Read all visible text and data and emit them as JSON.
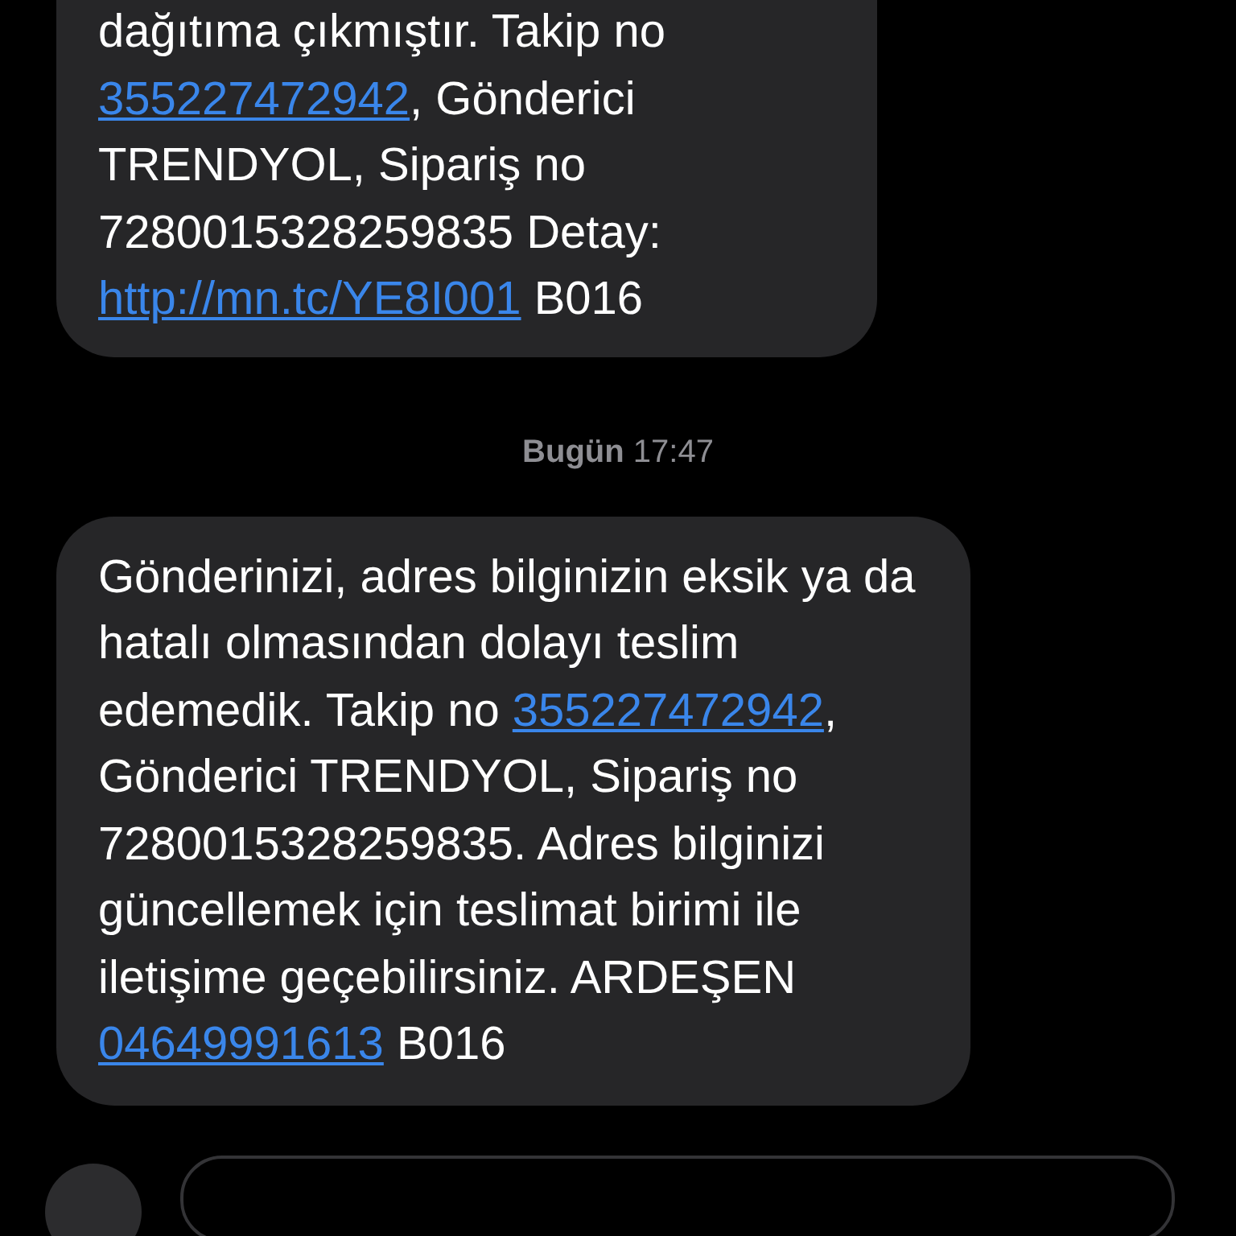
{
  "messages": [
    {
      "parts": [
        {
          "kind": "text",
          "text": "dağıtıma çıkmıştır. Takip no "
        },
        {
          "kind": "link",
          "text": "355227472942"
        },
        {
          "kind": "text",
          "text": ", Gönderici TRENDYOL, Sipariş no 7280015328259835 Detay: "
        },
        {
          "kind": "link",
          "text": "http://mn.tc/YE8I001"
        },
        {
          "kind": "text",
          "text": " B016"
        }
      ]
    },
    {
      "timestamp": {
        "day": "Bugün",
        "time": "17:47"
      },
      "parts": [
        {
          "kind": "text",
          "text": "Gönderinizi, adres bilginizin eksik ya da hatalı olmasından dolayı teslim edemedik. Takip no "
        },
        {
          "kind": "link",
          "text": "355227472942"
        },
        {
          "kind": "text",
          "text": ", Gönderici TRENDYOL, Sipariş no 7280015328259835. Adres bilginizi güncellemek için teslimat birimi ile iletişime geçebilirsiniz. ARDEŞEN "
        },
        {
          "kind": "link",
          "text": "04649991613"
        },
        {
          "kind": "text",
          "text": " B016"
        }
      ]
    }
  ]
}
